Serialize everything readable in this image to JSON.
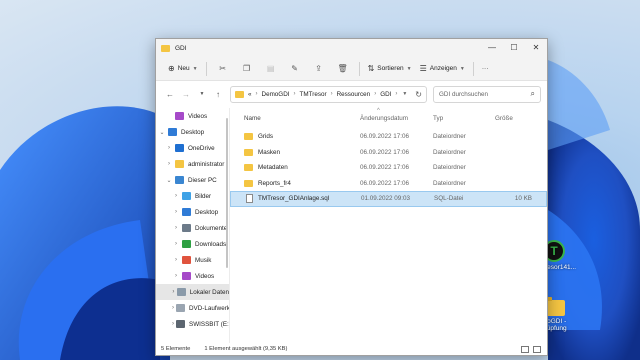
{
  "window": {
    "title": "GDI",
    "controls": {
      "minimize": "—",
      "maximize": "☐",
      "close": "✕"
    }
  },
  "toolbar": {
    "new_label": "Neu",
    "sort_label": "Sortieren",
    "view_label": "Anzeigen",
    "more_label": "···",
    "icons": [
      "cut-icon",
      "copy-icon",
      "paste-icon",
      "rename-icon",
      "share-icon",
      "delete-icon"
    ]
  },
  "address": {
    "prefix": "«",
    "crumbs": [
      "DemoGDI",
      "TMTresor",
      "Ressourcen",
      "GDI"
    ]
  },
  "search": {
    "placeholder": "GDI durchsuchen"
  },
  "sidebar": {
    "items": [
      {
        "label": "Videos",
        "color": "#a64ac9",
        "indent": 1,
        "chevron": ""
      },
      {
        "label": "Desktop",
        "color": "#2f7bd6",
        "indent": 0,
        "chevron": "v"
      },
      {
        "label": "OneDrive",
        "color": "#1f6fd1",
        "indent": 1,
        "chevron": ">"
      },
      {
        "label": "administrator",
        "color": "#f4c542",
        "indent": 1,
        "chevron": ">"
      },
      {
        "label": "Dieser PC",
        "color": "#3a86d1",
        "indent": 1,
        "chevron": "v"
      },
      {
        "label": "Bilder",
        "color": "#3fa2e6",
        "indent": 2,
        "chevron": ">"
      },
      {
        "label": "Desktop",
        "color": "#2f7bd6",
        "indent": 2,
        "chevron": ">"
      },
      {
        "label": "Dokumente",
        "color": "#6c7a89",
        "indent": 2,
        "chevron": ">"
      },
      {
        "label": "Downloads",
        "color": "#2ea043",
        "indent": 2,
        "chevron": ">"
      },
      {
        "label": "Musik",
        "color": "#e0533d",
        "indent": 2,
        "chevron": ">"
      },
      {
        "label": "Videos",
        "color": "#a64ac9",
        "indent": 2,
        "chevron": ">"
      },
      {
        "label": "Lokaler Daten",
        "color": "#8a9aa9",
        "indent": 2,
        "chevron": ">",
        "selected": true
      },
      {
        "label": "DVD-Laufwerk",
        "color": "#9aa5b1",
        "indent": 2,
        "chevron": ">"
      },
      {
        "label": "SWISSBIT (E:)",
        "color": "#5c6670",
        "indent": 2,
        "chevron": ">"
      }
    ]
  },
  "columns": {
    "name": "Name",
    "date": "Änderungsdatum",
    "type": "Typ",
    "size": "Größe"
  },
  "files": [
    {
      "name": "Grids",
      "date": "06.09.2022 17:06",
      "type": "Dateiordner",
      "size": "",
      "kind": "folder"
    },
    {
      "name": "Masken",
      "date": "06.09.2022 17:06",
      "type": "Dateiordner",
      "size": "",
      "kind": "folder"
    },
    {
      "name": "Metadaten",
      "date": "06.09.2022 17:06",
      "type": "Dateiordner",
      "size": "",
      "kind": "folder"
    },
    {
      "name": "Reports_fr4",
      "date": "06.09.2022 17:06",
      "type": "Dateiordner",
      "size": "",
      "kind": "folder"
    },
    {
      "name": "TMTresor_GDIAnlage.sql",
      "date": "01.09.2022 09:03",
      "type": "SQL-Datei",
      "size": "10 KB",
      "kind": "file",
      "selected": true
    }
  ],
  "status": {
    "count": "5 Elemente",
    "selection": "1 Element ausgewählt (9,35 KB)"
  },
  "desktop_icons": [
    {
      "label": "TMTresor141...",
      "kind": "tm-logo"
    },
    {
      "label": "...oGDI - ...üpfung",
      "kind": "folder"
    }
  ]
}
